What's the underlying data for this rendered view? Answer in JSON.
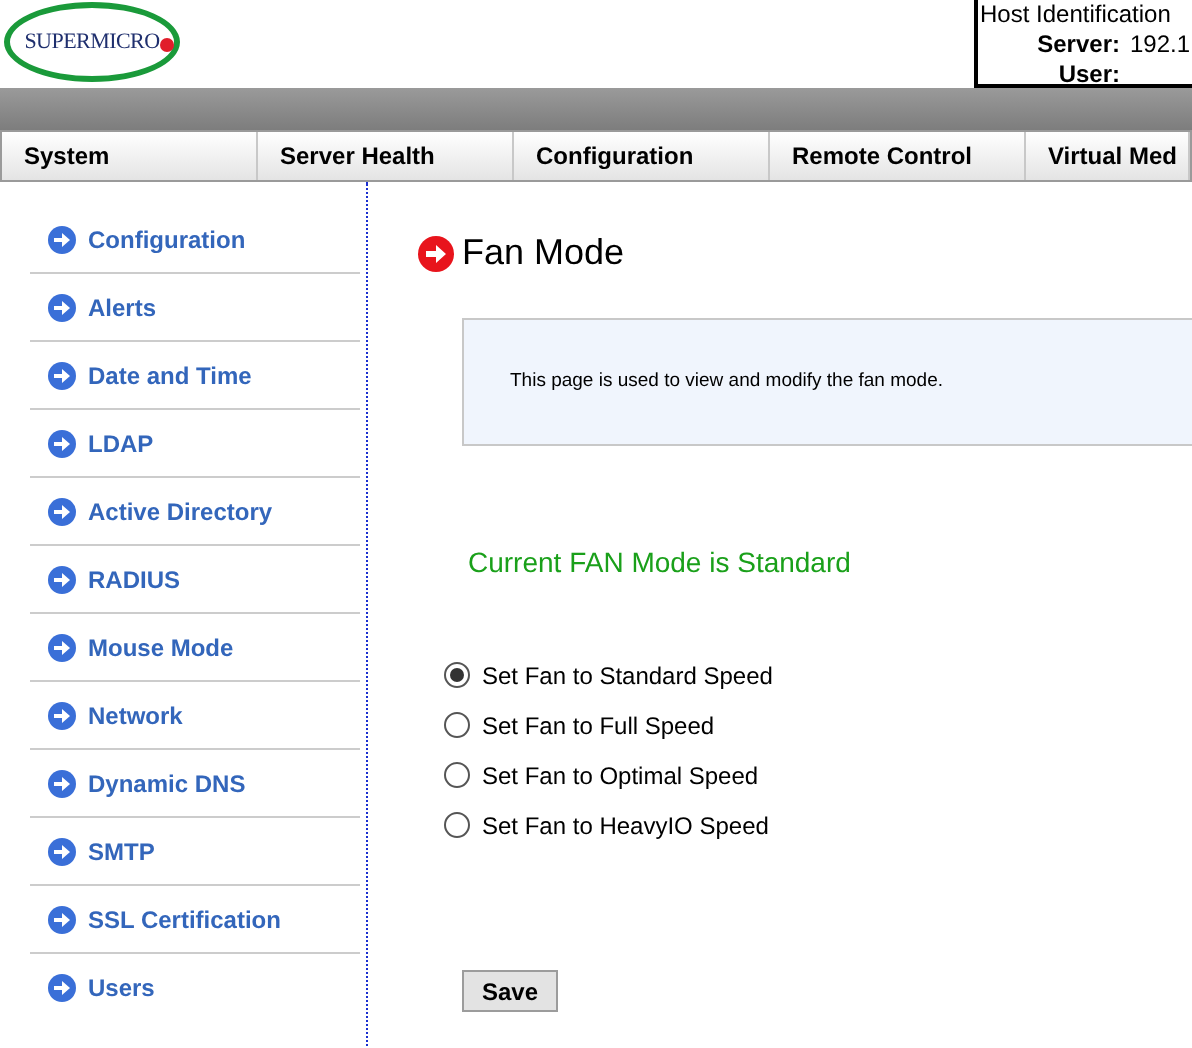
{
  "logo": {
    "text": "SUPERMICRO"
  },
  "host_box": {
    "title": "Host Identification",
    "fields": [
      {
        "label": "Server:",
        "value": "192.1"
      },
      {
        "label": "User:"
      }
    ]
  },
  "nav": {
    "tabs": [
      {
        "label": "System",
        "selected": false
      },
      {
        "label": "Server Health",
        "selected": false
      },
      {
        "label": "Configuration",
        "selected": false
      },
      {
        "label": "Remote Control",
        "selected": false
      },
      {
        "label": "Virtual Med",
        "selected": false
      }
    ]
  },
  "sidebar": {
    "items": [
      {
        "label": "Configuration"
      },
      {
        "label": "Alerts"
      },
      {
        "label": "Date and Time"
      },
      {
        "label": "LDAP"
      },
      {
        "label": "Active Directory"
      },
      {
        "label": "RADIUS"
      },
      {
        "label": "Mouse Mode"
      },
      {
        "label": "Network"
      },
      {
        "label": "Dynamic DNS"
      },
      {
        "label": "SMTP"
      },
      {
        "label": "SSL Certification"
      },
      {
        "label": "Users"
      }
    ]
  },
  "page": {
    "title": "Fan Mode",
    "description": "This page is used to view and modify the fan mode.",
    "status": "Current FAN Mode is Standard",
    "options": [
      {
        "label": "Set Fan to Standard Speed",
        "selected": true
      },
      {
        "label": "Set Fan to Full Speed",
        "selected": false
      },
      {
        "label": "Set Fan to Optimal Speed",
        "selected": false
      },
      {
        "label": "Set Fan to HeavyIO Speed",
        "selected": false
      }
    ],
    "save_button": "Save"
  }
}
